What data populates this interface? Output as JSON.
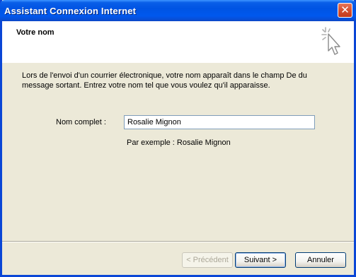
{
  "window": {
    "title": "Assistant Connexion Internet",
    "close_label": "✕"
  },
  "header": {
    "title": "Votre nom",
    "icon": "wizard-cursor-icon"
  },
  "body": {
    "description": "Lors de l'envoi d'un courrier électronique, votre nom apparaît dans le champ De du message sortant. Entrez votre nom tel que vous voulez qu'il apparaisse.",
    "field_label": "Nom complet :",
    "field_value": "Rosalie Mignon",
    "example": "Par exemple : Rosalie Mignon"
  },
  "buttons": {
    "back": "< Précédent",
    "next": "Suivant >",
    "cancel": "Annuler"
  },
  "colors": {
    "titlebar": "#0054e3",
    "close_button": "#d6502f",
    "dialog_background": "#ece9d8"
  }
}
